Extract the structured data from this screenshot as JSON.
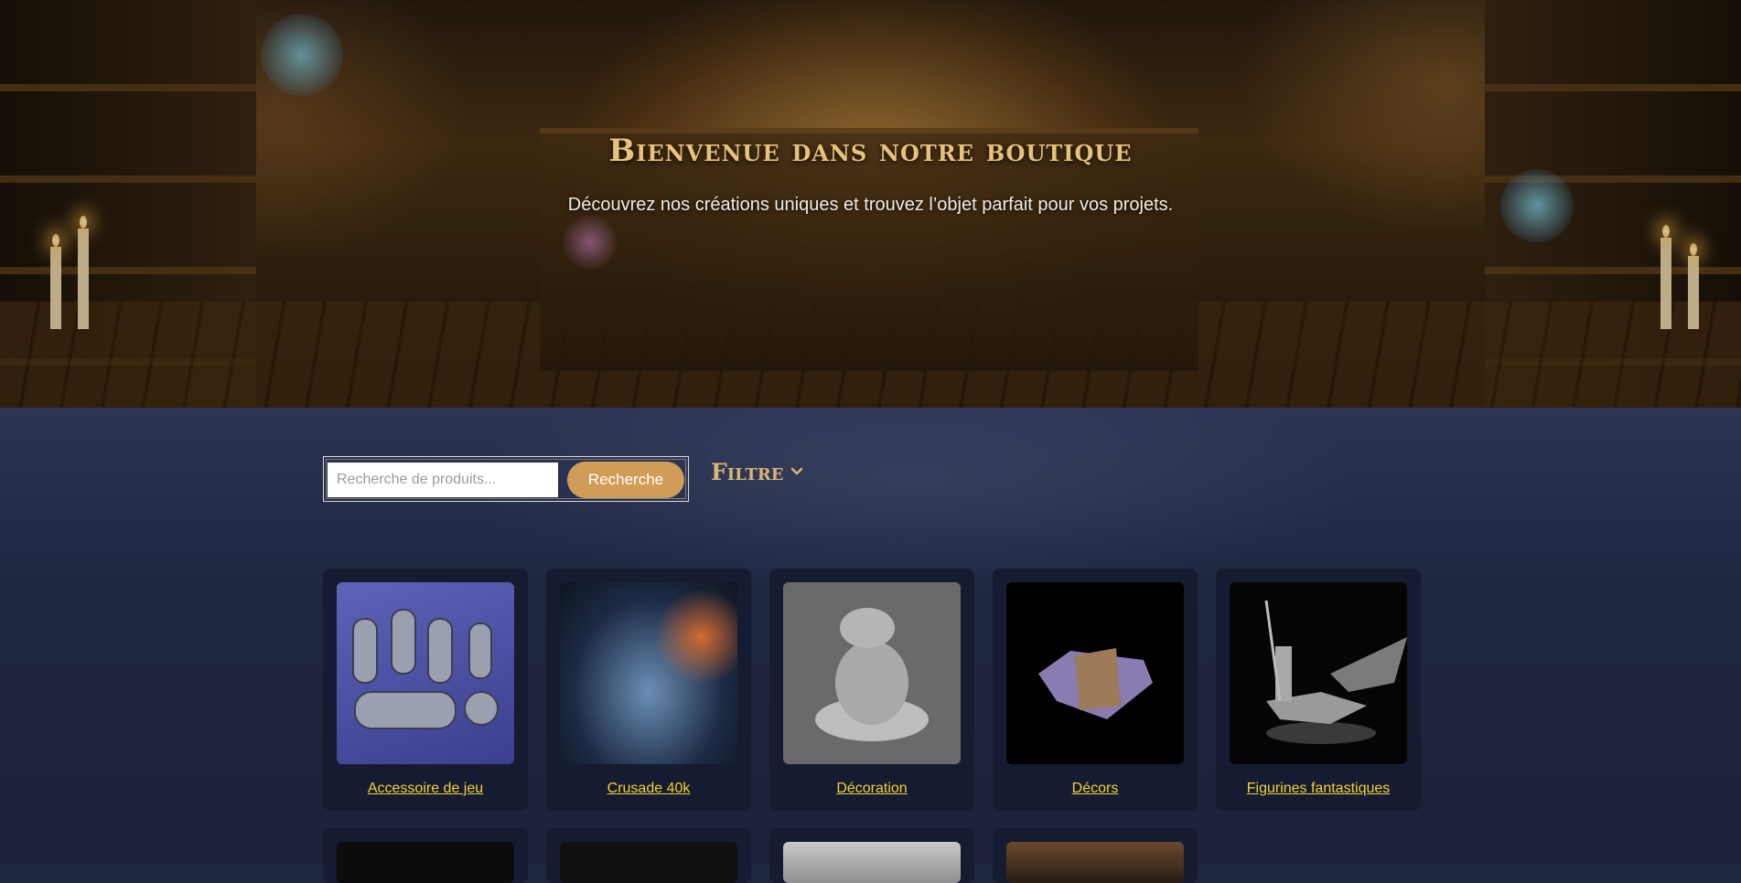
{
  "hero": {
    "title": "Bienvenue dans notre boutique",
    "subtitle": "Découvrez nos créations uniques et trouvez l’objet parfait pour vos projets."
  },
  "search": {
    "placeholder": "Recherche de produits...",
    "value": "",
    "button_label": "Recherche"
  },
  "filter": {
    "label": "Filtre",
    "icon": "chevron-down-icon"
  },
  "categories": [
    {
      "label": "Accessoire de jeu"
    },
    {
      "label": "Crusade 40k"
    },
    {
      "label": "Décoration"
    },
    {
      "label": "Décors"
    },
    {
      "label": "Figurines fantastiques"
    }
  ],
  "colors": {
    "accent": "#d09c57",
    "link": "#f4d234",
    "title": "#e6c27a",
    "background": "#1e2640",
    "card": "#151b30"
  }
}
